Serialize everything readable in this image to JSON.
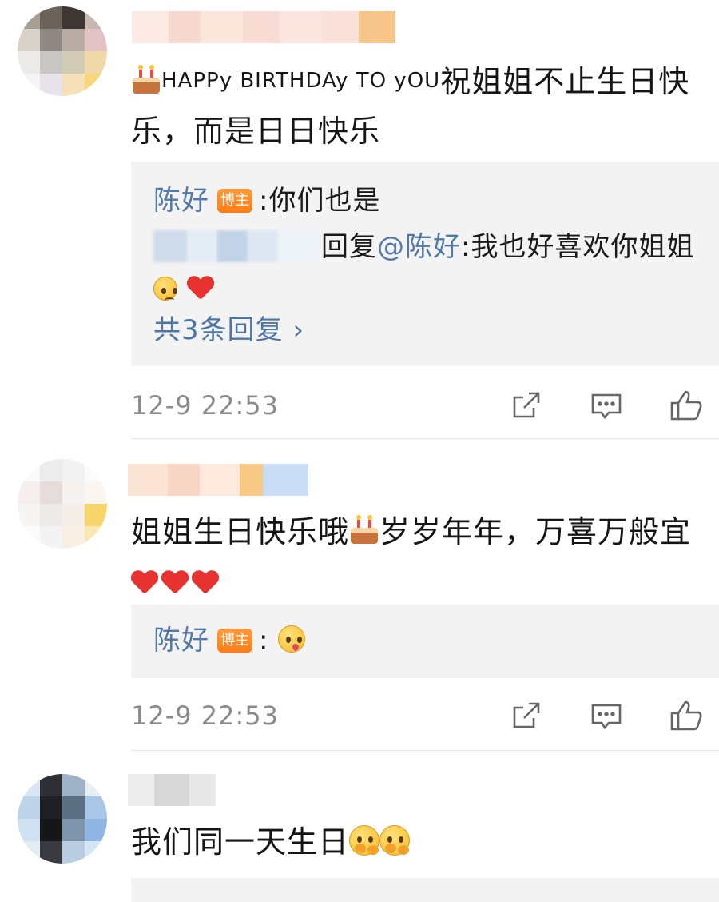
{
  "comments": [
    {
      "text_en": "HAPPy BIRTHDAy TO yOU",
      "text_line1": "祝姐姐不止生日快",
      "text_line2": "乐，而是日日快乐",
      "replies": [
        {
          "user": "陈好",
          "badge": "博主",
          "sep": ":",
          "text": "你们也是"
        },
        {
          "reply_word": "回复",
          "mention": "@陈好",
          "text": ":我也好喜欢你姐姐"
        }
      ],
      "more_replies": "共3条回复 ›",
      "time": "12-9 22:53"
    },
    {
      "text_line1": "姐姐生日快乐哦",
      "text_line1b": "岁岁年年，万喜万般宜",
      "replies": [
        {
          "user": "陈好",
          "badge": "博主",
          "sep": ":"
        }
      ],
      "time": "12-9 22:53"
    },
    {
      "text_line1": "我们同一天生日"
    }
  ],
  "icons": {
    "share": "share-icon",
    "comment": "comment-icon",
    "like": "like-icon"
  },
  "colors": {
    "username": "#5178a7",
    "badge": "#ff8a24",
    "heart": "#e8322f",
    "meta": "#8a8a8a",
    "reply_bg": "#f3f3f3"
  }
}
